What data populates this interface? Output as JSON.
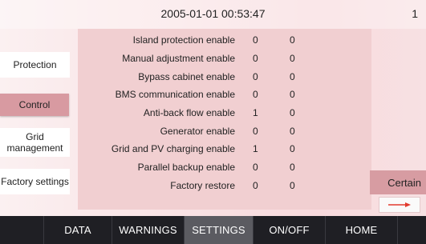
{
  "header": {
    "datetime": "2005-01-01  00:53:47",
    "page_number": "1"
  },
  "sidebar": {
    "items": [
      {
        "label": "Protection"
      },
      {
        "label": "Control"
      },
      {
        "label": "Grid management"
      },
      {
        "label": "Factory settings"
      }
    ],
    "active_item": "Control"
  },
  "settings": {
    "rows": [
      {
        "label": "Island protection enable",
        "value1": "0",
        "value2": "0"
      },
      {
        "label": "Manual adjustment enable",
        "value1": "0",
        "value2": "0"
      },
      {
        "label": "Bypass cabinet enable",
        "value1": "0",
        "value2": "0"
      },
      {
        "label": "BMS communication enable",
        "value1": "0",
        "value2": "0"
      },
      {
        "label": "Anti-back flow enable",
        "value1": "1",
        "value2": "0"
      },
      {
        "label": "Generator enable",
        "value1": "0",
        "value2": "0"
      },
      {
        "label": "Grid and PV charging enable",
        "value1": "1",
        "value2": "0"
      },
      {
        "label": "Parallel backup enable",
        "value1": "0",
        "value2": "0"
      },
      {
        "label": "Factory restore",
        "value1": "0",
        "value2": "0"
      }
    ]
  },
  "actions": {
    "certain_label": "Certain",
    "next_icon": "right-arrow-icon"
  },
  "nav": {
    "tabs": [
      {
        "label": "DATA"
      },
      {
        "label": "WARNINGS"
      },
      {
        "label": "SETTINGS"
      },
      {
        "label": "ON/OFF"
      },
      {
        "label": "HOME"
      }
    ],
    "active_tab": "SETTINGS"
  },
  "colors": {
    "accent_red": "#e23a2e",
    "active_side": "#d89aa1",
    "nav_bg": "#1f1f24",
    "nav_active": "#5b5b61"
  }
}
